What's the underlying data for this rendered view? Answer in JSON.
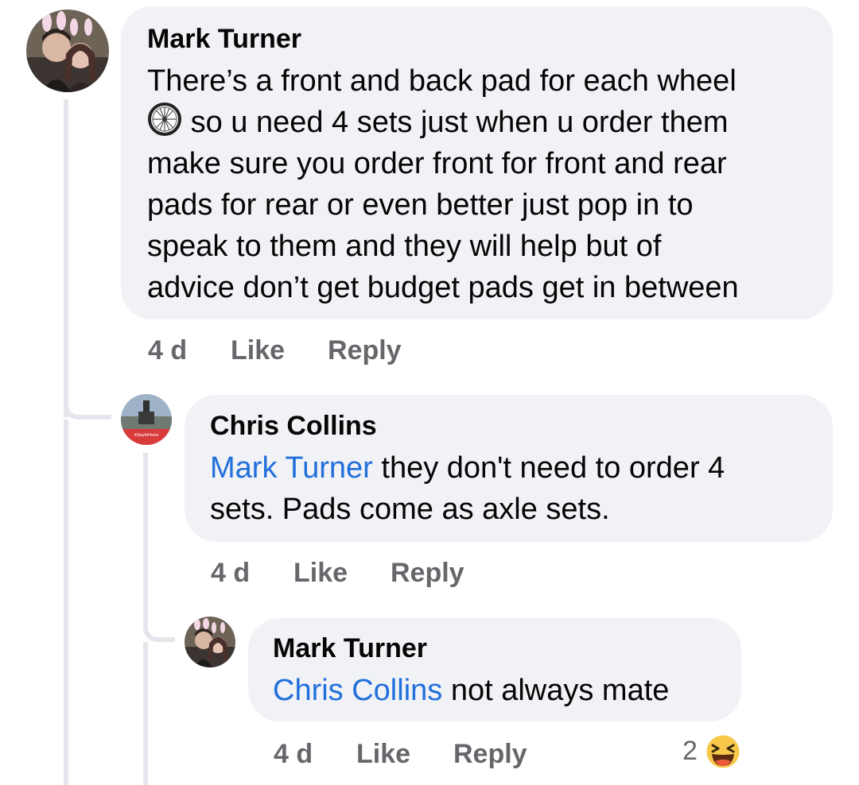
{
  "comments": [
    {
      "author": "Mark Turner",
      "text_lines": [
        "There’s a front and back pad for each wheel",
        "so u need 4 sets just when u order them",
        "make sure you order front for front and rear",
        "pads for rear or even better just pop in to",
        "speak to them and they will help but of",
        "advice don’t get budget pads get in between"
      ],
      "inline_icon": "wheel-icon",
      "time": "4 d",
      "like_label": "Like",
      "reply_label": "Reply"
    },
    {
      "author": "Chris Collins",
      "mention": "Mark Turner",
      "text_after_mention": " they don't need to order 4",
      "text_line2": "sets. Pads come as axle sets.",
      "avatar_banner_text": "#StayAtHome",
      "time": "4 d",
      "like_label": "Like",
      "reply_label": "Reply"
    },
    {
      "author": "Mark Turner",
      "mention": "Chris Collins",
      "text_after_mention": " not always mate",
      "time": "4 d",
      "like_label": "Like",
      "reply_label": "Reply",
      "reaction_count": "2",
      "reaction_icon": "laughing-emoji-icon"
    }
  ],
  "colors": {
    "bubble": "#f0f2f5",
    "mention": "#216fdb",
    "meta": "#65676b",
    "thread_line": "#e4e6eb"
  }
}
